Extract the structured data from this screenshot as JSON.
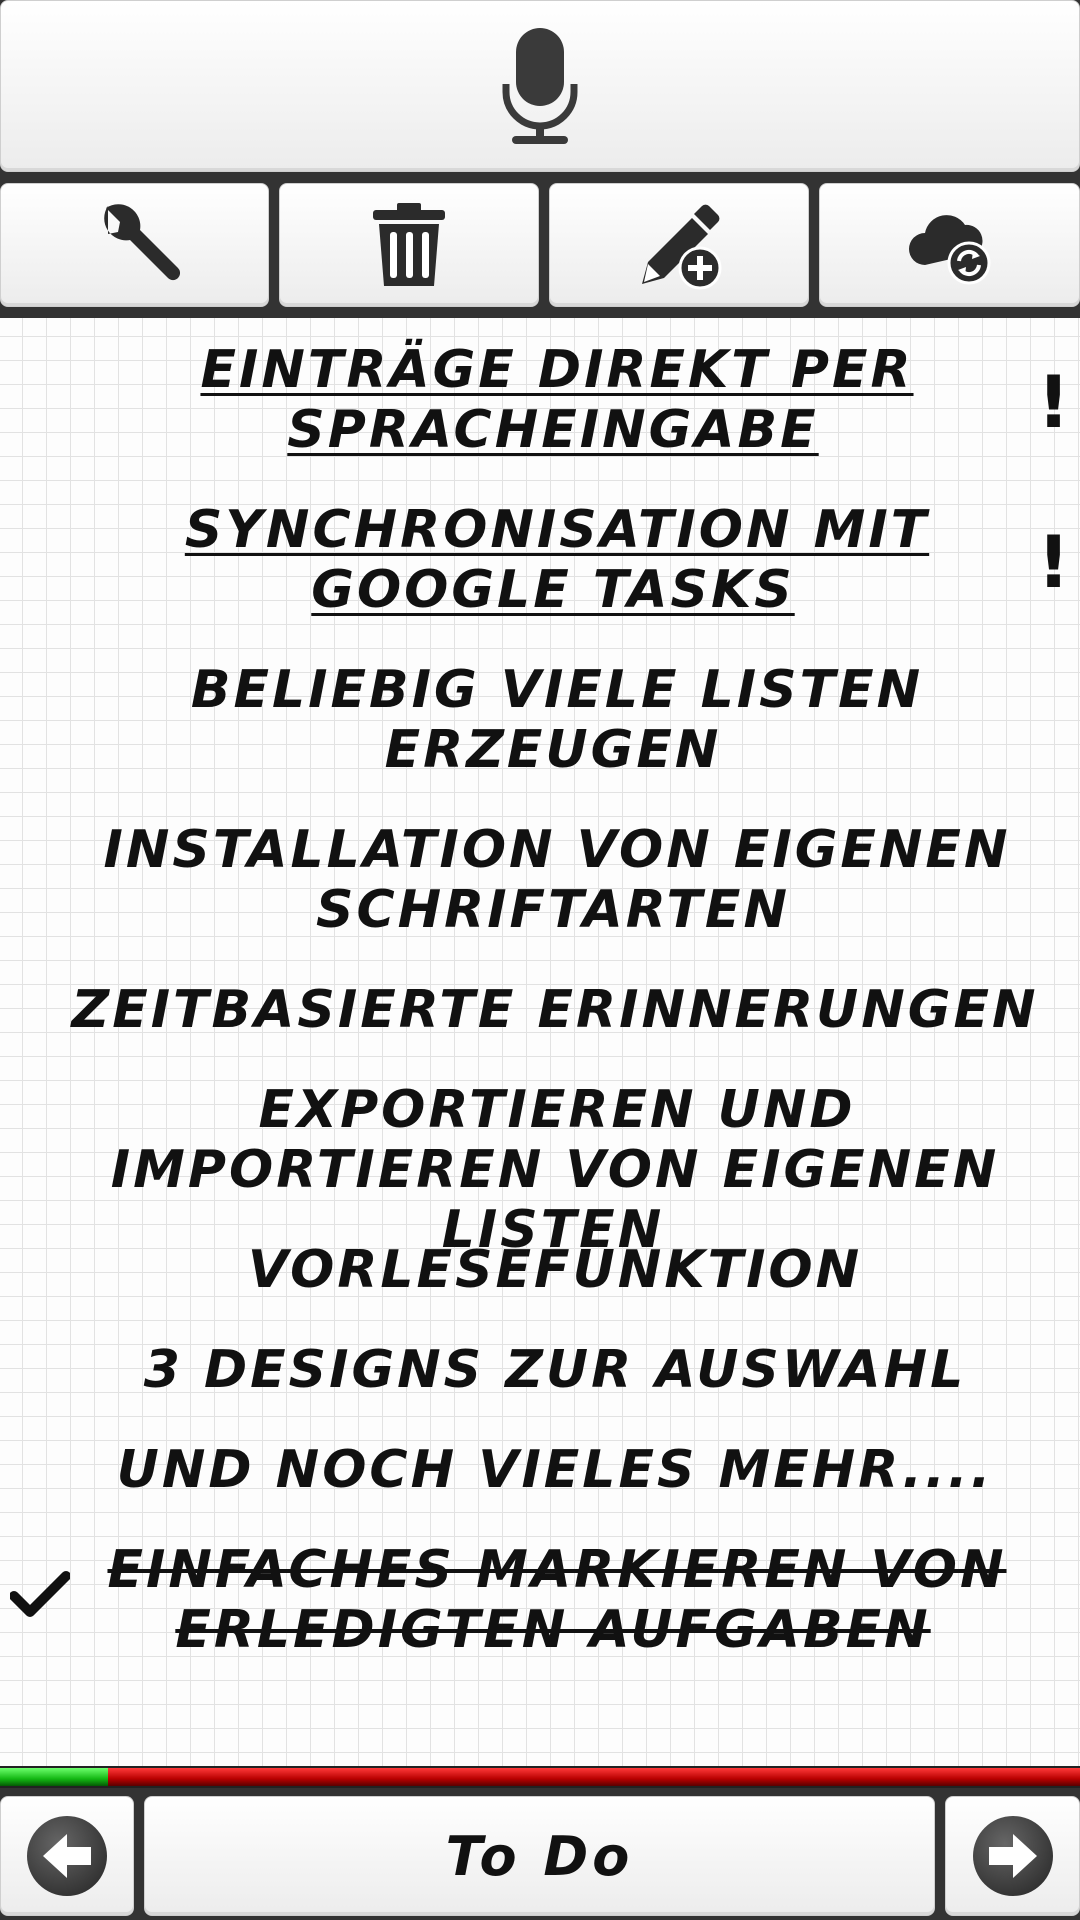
{
  "app": {
    "mic_icon": "microphone-icon",
    "toolbar": [
      {
        "name": "settings-button",
        "icon": "wrench-icon"
      },
      {
        "name": "delete-button",
        "icon": "trash-icon"
      },
      {
        "name": "add-entry-button",
        "icon": "pencil-plus-icon"
      },
      {
        "name": "sync-button",
        "icon": "cloud-sync-icon"
      }
    ]
  },
  "list": {
    "items": [
      {
        "text": "Einträge direkt per Spracheingabe",
        "important": true,
        "done": false
      },
      {
        "text": "Synchronisation mit Google Tasks",
        "important": true,
        "done": false
      },
      {
        "text": "Beliebig viele Listen erzeugen",
        "important": false,
        "done": false
      },
      {
        "text": "Installation von eigenen Schriftarten",
        "important": false,
        "done": false
      },
      {
        "text": "Zeitbasierte Erinnerungen",
        "important": false,
        "done": false
      },
      {
        "text": "Exportieren und Importieren von eigenen Listen",
        "important": false,
        "done": false
      },
      {
        "text": "Vorlesefunktion",
        "important": false,
        "done": false
      },
      {
        "text": "3 Designs zur Auswahl",
        "important": false,
        "done": false
      },
      {
        "text": "und noch vieles mehr....",
        "important": false,
        "done": false
      },
      {
        "text": "Einfaches Markieren von erledigten Aufgaben",
        "important": false,
        "done": true
      }
    ],
    "important_mark": "!",
    "progress_done_fraction": 0.1
  },
  "footer": {
    "title": "To Do",
    "prev_icon": "arrow-left-icon",
    "next_icon": "arrow-right-icon"
  },
  "colors": {
    "progress_done": "#14b814",
    "progress_open": "#c40000"
  }
}
